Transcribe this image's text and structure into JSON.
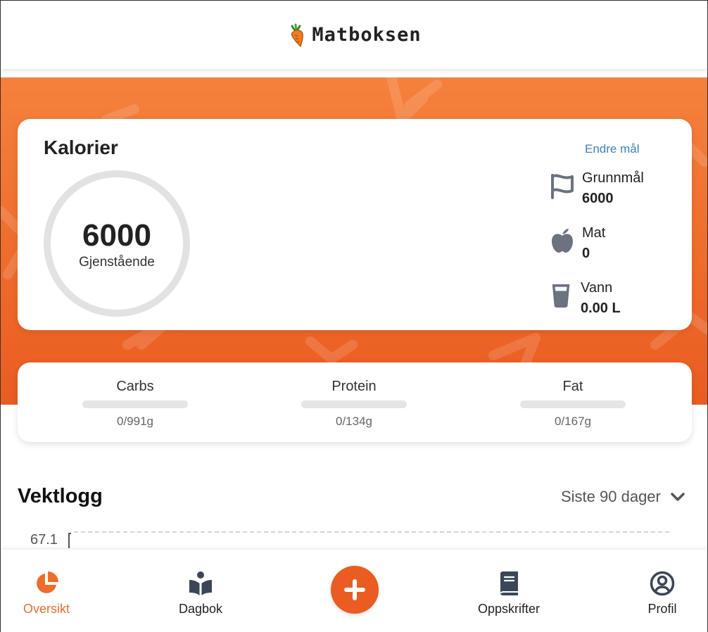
{
  "app": {
    "title": "Matboksen"
  },
  "calories": {
    "title": "Kalorier",
    "remaining_value": "6000",
    "remaining_label": "Gjenstående",
    "edit_goal_label": "Endre mål",
    "stats": [
      {
        "icon": "flag-icon",
        "label": "Grunnmål",
        "value": "6000"
      },
      {
        "icon": "apple-icon",
        "label": "Mat",
        "value": "0"
      },
      {
        "icon": "water-glass-icon",
        "label": "Vann",
        "value": "0.00 L"
      }
    ]
  },
  "macros": [
    {
      "name": "Carbs",
      "amount": "0/991g",
      "progress": 0
    },
    {
      "name": "Protein",
      "amount": "0/134g",
      "progress": 0
    },
    {
      "name": "Fat",
      "amount": "0/167g",
      "progress": 0
    }
  ],
  "weight_log": {
    "title": "Vektlogg",
    "range_label": "Siste 90 dager",
    "y_tick_top": "67.1"
  },
  "nav": {
    "items": [
      {
        "label": "Oversikt",
        "icon": "pie-chart-icon",
        "active": true
      },
      {
        "label": "Dagbok",
        "icon": "open-book-icon",
        "active": false
      },
      {
        "label": "Oppskrifter",
        "icon": "recipe-book-icon",
        "active": false
      },
      {
        "label": "Profil",
        "icon": "user-circle-icon",
        "active": false
      }
    ],
    "add_icon": "plus-icon"
  },
  "colors": {
    "accent": "#ef6c2b",
    "accent_dark": "#ea5c22",
    "link": "#3b82c4",
    "icon_gray": "#6b7280"
  }
}
